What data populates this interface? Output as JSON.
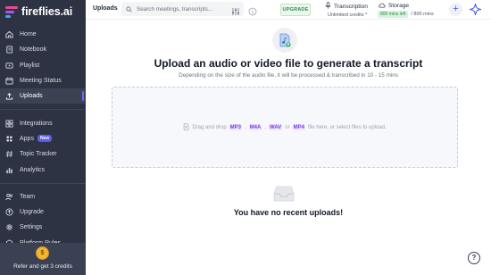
{
  "brand": {
    "name": "fireflies.ai"
  },
  "sidebar": {
    "group1": [
      {
        "label": "Home",
        "icon": "home-icon"
      },
      {
        "label": "Notebook",
        "icon": "notebook-icon"
      },
      {
        "label": "Playlist",
        "icon": "playlist-icon"
      },
      {
        "label": "Meeting Status",
        "icon": "meeting-status-icon"
      },
      {
        "label": "Uploads",
        "icon": "upload-icon",
        "active": true
      }
    ],
    "group2": [
      {
        "label": "Integrations",
        "icon": "integrations-icon"
      },
      {
        "label": "Apps",
        "icon": "apps-icon",
        "badge": "New"
      },
      {
        "label": "Topic Tracker",
        "icon": "hashtag-icon"
      },
      {
        "label": "Analytics",
        "icon": "analytics-icon"
      }
    ],
    "group3": [
      {
        "label": "Team",
        "icon": "team-icon"
      },
      {
        "label": "Upgrade",
        "icon": "upgrade-icon"
      },
      {
        "label": "Settings",
        "icon": "gear-icon"
      },
      {
        "label": "Platform Rules",
        "icon": "rules-icon"
      }
    ],
    "refer": {
      "label": "Refer and get 3 credits",
      "coin": "$"
    }
  },
  "topbar": {
    "page_tab": "Uploads",
    "search_placeholder": "Search meetings, transcripts...",
    "upgrade_label": "UPGRADE",
    "transcription": {
      "title": "Transcription",
      "value": "Unlimited credits *"
    },
    "storage": {
      "title": "Storage",
      "used": "800 mins left",
      "total": "/ 800 mins"
    },
    "add_label": "+"
  },
  "main": {
    "title": "Upload an audio or video file to generate a transcript",
    "subtitle": "Depending on the size of the audio file, it will be processed & transcribed in 10 - 15 mins",
    "dropzone": {
      "prefix": "Drag and drop",
      "formats": [
        "MP3",
        "M4A",
        "WAV"
      ],
      "or": "or",
      "format_last": "MP4",
      "suffix": "file here, or select files to upload."
    },
    "empty_title": "You have no recent uploads!"
  },
  "help": {
    "label": "?"
  },
  "colors": {
    "sidebar_bg": "#2d3343",
    "accent": "#6c6cf2",
    "upgrade_green": "#2f8b4a",
    "format_purple": "#7c3aed"
  }
}
